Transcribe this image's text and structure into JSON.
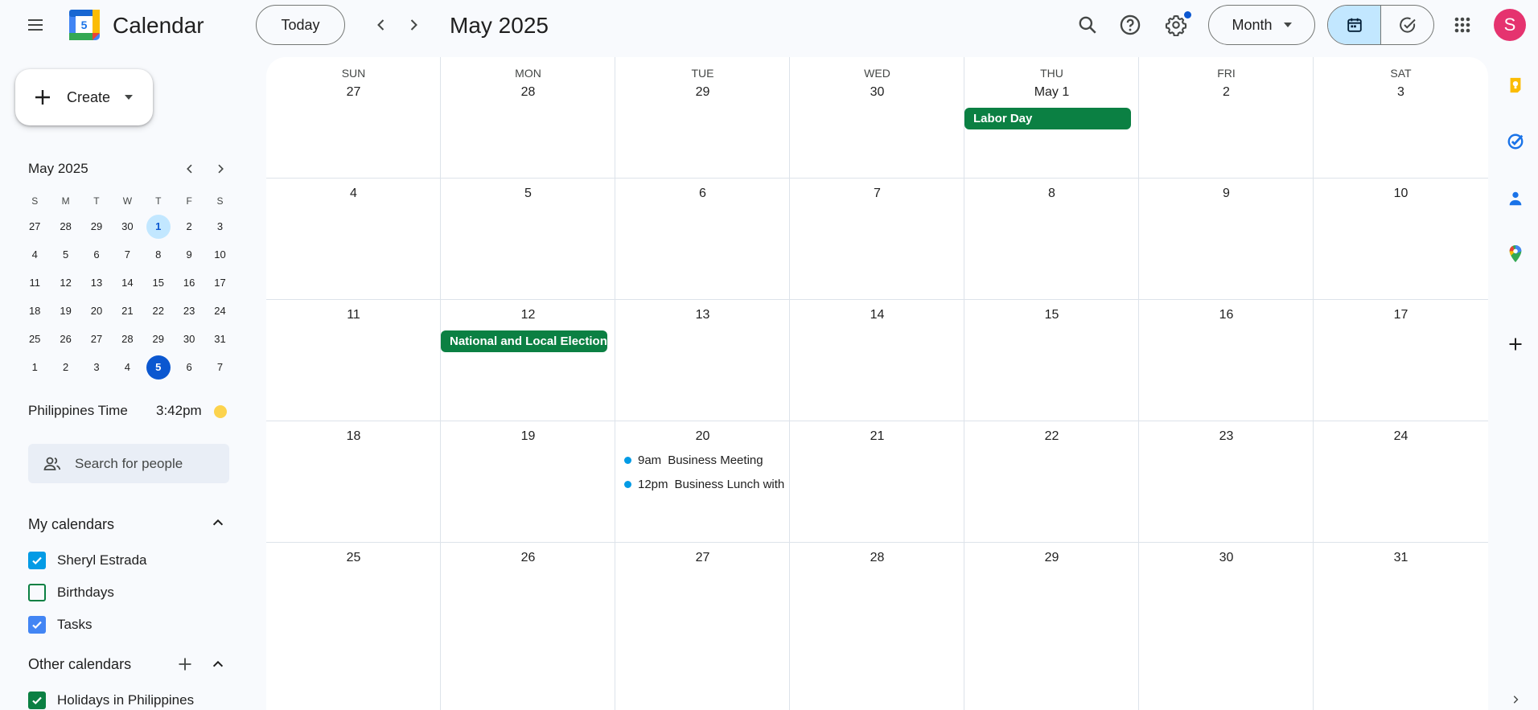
{
  "app": {
    "title": "Calendar",
    "logo_day": "5"
  },
  "toolbar": {
    "today_label": "Today",
    "period_title": "May 2025",
    "view_label": "Month"
  },
  "user": {
    "initial": "S",
    "avatar_color": "#e5336f"
  },
  "sidebar": {
    "create_label": "Create",
    "mini_calendar": {
      "title": "May 2025",
      "weekday_headers": [
        "S",
        "M",
        "T",
        "W",
        "T",
        "F",
        "S"
      ],
      "weeks": [
        [
          "27",
          "28",
          "29",
          "30",
          "1",
          "2",
          "3"
        ],
        [
          "4",
          "5",
          "6",
          "7",
          "8",
          "9",
          "10"
        ],
        [
          "11",
          "12",
          "13",
          "14",
          "15",
          "16",
          "17"
        ],
        [
          "18",
          "19",
          "20",
          "21",
          "22",
          "23",
          "24"
        ],
        [
          "25",
          "26",
          "27",
          "28",
          "29",
          "30",
          "31"
        ],
        [
          "1",
          "2",
          "3",
          "4",
          "5",
          "6",
          "7"
        ]
      ],
      "selected_day": "1",
      "today_day": "5"
    },
    "timezone": {
      "label": "Philippines Time",
      "time": "3:42pm"
    },
    "people_search_placeholder": "Search for people",
    "my_calendars": {
      "title": "My calendars",
      "items": [
        {
          "label": "Sheryl Estrada",
          "checked": true,
          "color": "#039be5"
        },
        {
          "label": "Birthdays",
          "checked": false,
          "color": "#0b8043"
        },
        {
          "label": "Tasks",
          "checked": true,
          "color": "#4285f4"
        }
      ]
    },
    "other_calendars": {
      "title": "Other calendars",
      "items": [
        {
          "label": "Holidays in Philippines",
          "checked": true,
          "color": "#0b8043"
        }
      ]
    }
  },
  "month_grid": {
    "weekday_headers": [
      "SUN",
      "MON",
      "TUE",
      "WED",
      "THU",
      "FRI",
      "SAT"
    ],
    "weeks": [
      [
        "27",
        "28",
        "29",
        "30",
        "May 1",
        "2",
        "3"
      ],
      [
        "4",
        "5",
        "6",
        "7",
        "8",
        "9",
        "10"
      ],
      [
        "11",
        "12",
        "13",
        "14",
        "15",
        "16",
        "17"
      ],
      [
        "18",
        "19",
        "20",
        "21",
        "22",
        "23",
        "24"
      ],
      [
        "25",
        "26",
        "27",
        "28",
        "29",
        "30",
        "31"
      ]
    ],
    "all_day_events": [
      {
        "title": "Labor Day",
        "week": 0,
        "day": 4,
        "color": "#0b8043"
      },
      {
        "title": "National and Local Elections",
        "week": 2,
        "day": 1,
        "color": "#0b8043"
      }
    ],
    "timed_events": [
      {
        "time": "9am",
        "title": "Business Meeting",
        "week": 3,
        "day": 2,
        "color": "#039be5"
      },
      {
        "time": "12pm",
        "title": "Business Lunch with",
        "week": 3,
        "day": 2,
        "color": "#039be5"
      }
    ]
  },
  "right_rail": {
    "icons": [
      "keep-icon",
      "tasks-icon",
      "contacts-icon",
      "maps-icon",
      "add-icon"
    ]
  }
}
